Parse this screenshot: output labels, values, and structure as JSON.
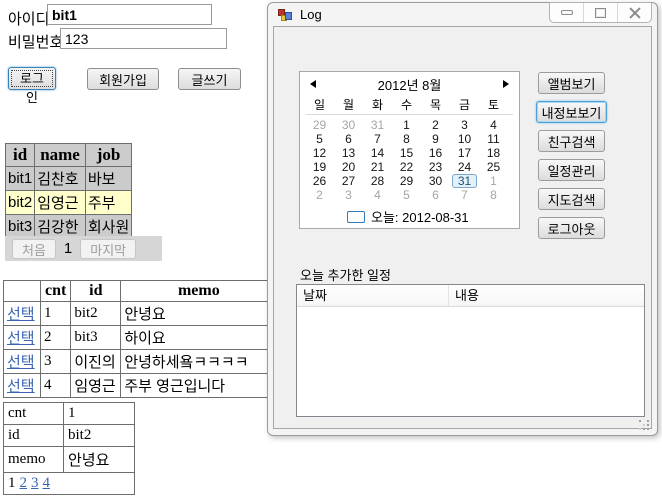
{
  "page": {
    "login": {
      "id_label": "아이디",
      "id_value": "bit1",
      "pw_label": "비밀번호",
      "pw_value": "123",
      "login_button": "로그인",
      "signup_button": "회원가입",
      "write_button": "글쓰기"
    },
    "members_table": {
      "headers": [
        "id",
        "name",
        "job"
      ],
      "rows": [
        {
          "id": "bit1",
          "name": "김찬호",
          "job": "바보",
          "highlight": false
        },
        {
          "id": "bit2",
          "name": "임영근",
          "job": "주부",
          "highlight": true
        },
        {
          "id": "bit3",
          "name": "김강한",
          "job": "회사원",
          "highlight": false
        }
      ]
    },
    "members_pager": {
      "first_button": "처음",
      "current_page": "1",
      "last_button": "마지막"
    },
    "memo_table": {
      "headers": [
        "",
        "cnt",
        "id",
        "memo"
      ],
      "rows": [
        {
          "select": "선택",
          "cnt": "1",
          "id": "bit2",
          "memo": "안녕요"
        },
        {
          "select": "선택",
          "cnt": "2",
          "id": "bit3",
          "memo": "하이요"
        },
        {
          "select": "선택",
          "cnt": "3",
          "id": "이진의",
          "memo": "안녕하세욬ㅋㅋㅋㅋ"
        },
        {
          "select": "선택",
          "cnt": "4",
          "id": "임영근",
          "memo": "주부 영근입니다"
        }
      ]
    },
    "memo_detail": {
      "rows": [
        [
          "cnt",
          "1"
        ],
        [
          "id",
          "bit2"
        ],
        [
          "memo",
          "안녕요"
        ]
      ],
      "pager_current": "1",
      "pager_links": [
        "2",
        "3",
        "4"
      ]
    }
  },
  "window": {
    "title": "Log",
    "calendar": {
      "title": "2012년 8월",
      "day_headers": [
        "일",
        "월",
        "화",
        "수",
        "목",
        "금",
        "토"
      ],
      "weeks": [
        [
          {
            "d": "29",
            "muted": true
          },
          {
            "d": "30",
            "muted": true
          },
          {
            "d": "31",
            "muted": true
          },
          {
            "d": "1"
          },
          {
            "d": "2"
          },
          {
            "d": "3"
          },
          {
            "d": "4"
          }
        ],
        [
          {
            "d": "5"
          },
          {
            "d": "6"
          },
          {
            "d": "7"
          },
          {
            "d": "8"
          },
          {
            "d": "9"
          },
          {
            "d": "10"
          },
          {
            "d": "11"
          }
        ],
        [
          {
            "d": "12"
          },
          {
            "d": "13"
          },
          {
            "d": "14"
          },
          {
            "d": "15"
          },
          {
            "d": "16"
          },
          {
            "d": "17"
          },
          {
            "d": "18"
          }
        ],
        [
          {
            "d": "19"
          },
          {
            "d": "20"
          },
          {
            "d": "21"
          },
          {
            "d": "22"
          },
          {
            "d": "23"
          },
          {
            "d": "24"
          },
          {
            "d": "25"
          }
        ],
        [
          {
            "d": "26"
          },
          {
            "d": "27"
          },
          {
            "d": "28"
          },
          {
            "d": "29"
          },
          {
            "d": "30"
          },
          {
            "d": "31",
            "selected": true
          },
          {
            "d": "1",
            "muted": true
          }
        ],
        [
          {
            "d": "2",
            "muted": true
          },
          {
            "d": "3",
            "muted": true
          },
          {
            "d": "4",
            "muted": true
          },
          {
            "d": "5",
            "muted": true
          },
          {
            "d": "6",
            "muted": true
          },
          {
            "d": "7",
            "muted": true
          },
          {
            "d": "8",
            "muted": true
          }
        ]
      ],
      "selected_date": "31",
      "today_label": "오늘: 2012-08-31"
    },
    "side_buttons": [
      "앨범보기",
      "내정보보기",
      "친구검색",
      "일정관리",
      "지도검색",
      "로그아웃"
    ],
    "focused_button": "내정보보기",
    "schedule_label": "오늘 추가한 일정",
    "list_columns": [
      "날짜",
      "내용"
    ]
  },
  "colors": {
    "highlight_row": "#ffffcc",
    "gray_row": "#cccccc",
    "link_blue": "#3b64b0",
    "selection_border": "#7ba7cc",
    "selection_fill": "#e3f1fb",
    "focus_button_border": "#4f9fd4"
  }
}
